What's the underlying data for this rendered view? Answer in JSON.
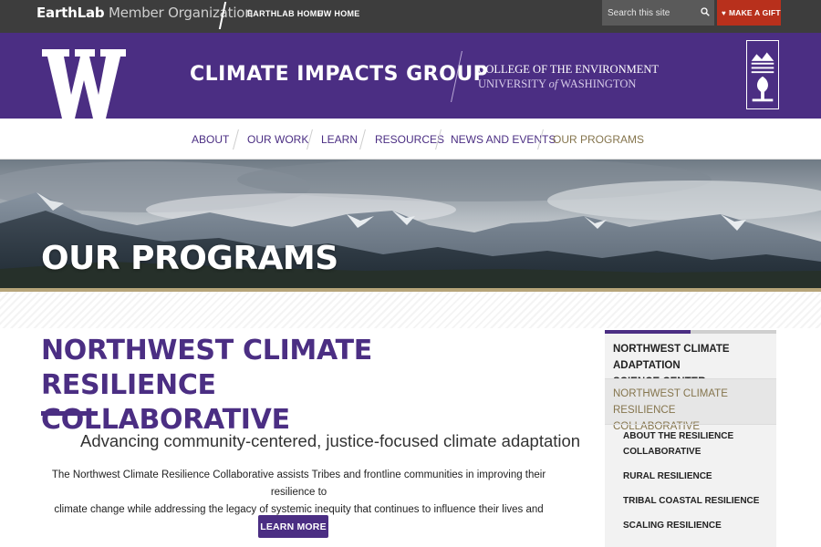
{
  "topbar": {
    "org_bold": "EarthLab",
    "org_light": " Member Organization",
    "links": [
      "EARTHLAB HOME",
      "UW HOME"
    ],
    "search_placeholder": "Search this site",
    "gift_label": "MAKE A GIFT"
  },
  "header": {
    "logo_letter": "W",
    "site_title": "CLIMATE IMPACTS GROUP",
    "college_line1": "COLLEGE OF THE ENVIRONMENT",
    "college_line2_a": "UNIVERSITY ",
    "college_line2_of": "of",
    "college_line2_b": " WASHINGTON"
  },
  "nav": {
    "items": [
      {
        "label": "ABOUT",
        "active": false
      },
      {
        "label": "OUR WORK",
        "active": false
      },
      {
        "label": "LEARN",
        "active": false
      },
      {
        "label": "RESOURCES",
        "active": false
      },
      {
        "label": "NEWS AND EVENTS",
        "active": false
      },
      {
        "label": "OUR PROGRAMS",
        "active": true
      }
    ]
  },
  "hero": {
    "title": "OUR PROGRAMS"
  },
  "main": {
    "title_line1": "NORTHWEST CLIMATE RESILIENCE",
    "title_line2": "COLLABORATIVE",
    "subtitle": "Advancing community-centered, justice-focused climate adaptation",
    "body_line1": "The Northwest Climate Resilience Collaborative assists Tribes and frontline communities in improving their resilience to",
    "body_line2": "climate change while addressing the legacy of systemic inequity that continues to influence their lives and livelihoods.",
    "button_label": "LEARN MORE"
  },
  "sidebar": {
    "items": [
      {
        "line1": "NORTHWEST CLIMATE ADAPTATION",
        "line2": "SCIENCE CENTER",
        "active": false
      },
      {
        "line1": "NORTHWEST CLIMATE RESILIENCE",
        "line2": "COLLABORATIVE",
        "active": true
      }
    ],
    "subitems": [
      {
        "line1": "ABOUT THE RESILIENCE",
        "line2": "COLLABORATIVE"
      },
      {
        "line1": "RURAL RESILIENCE",
        "line2": ""
      },
      {
        "line1": "TRIBAL COASTAL RESILIENCE",
        "line2": ""
      },
      {
        "line1": "SCALING RESILIENCE",
        "line2": ""
      }
    ]
  },
  "colors": {
    "uw_purple": "#4b2e83",
    "uw_gold": "#85754d",
    "gift_red": "#b8301c",
    "topbar": "#3d3d3d"
  },
  "icons": [
    "search-icon",
    "heart-icon",
    "uw-w-logo",
    "college-seal-icon"
  ]
}
